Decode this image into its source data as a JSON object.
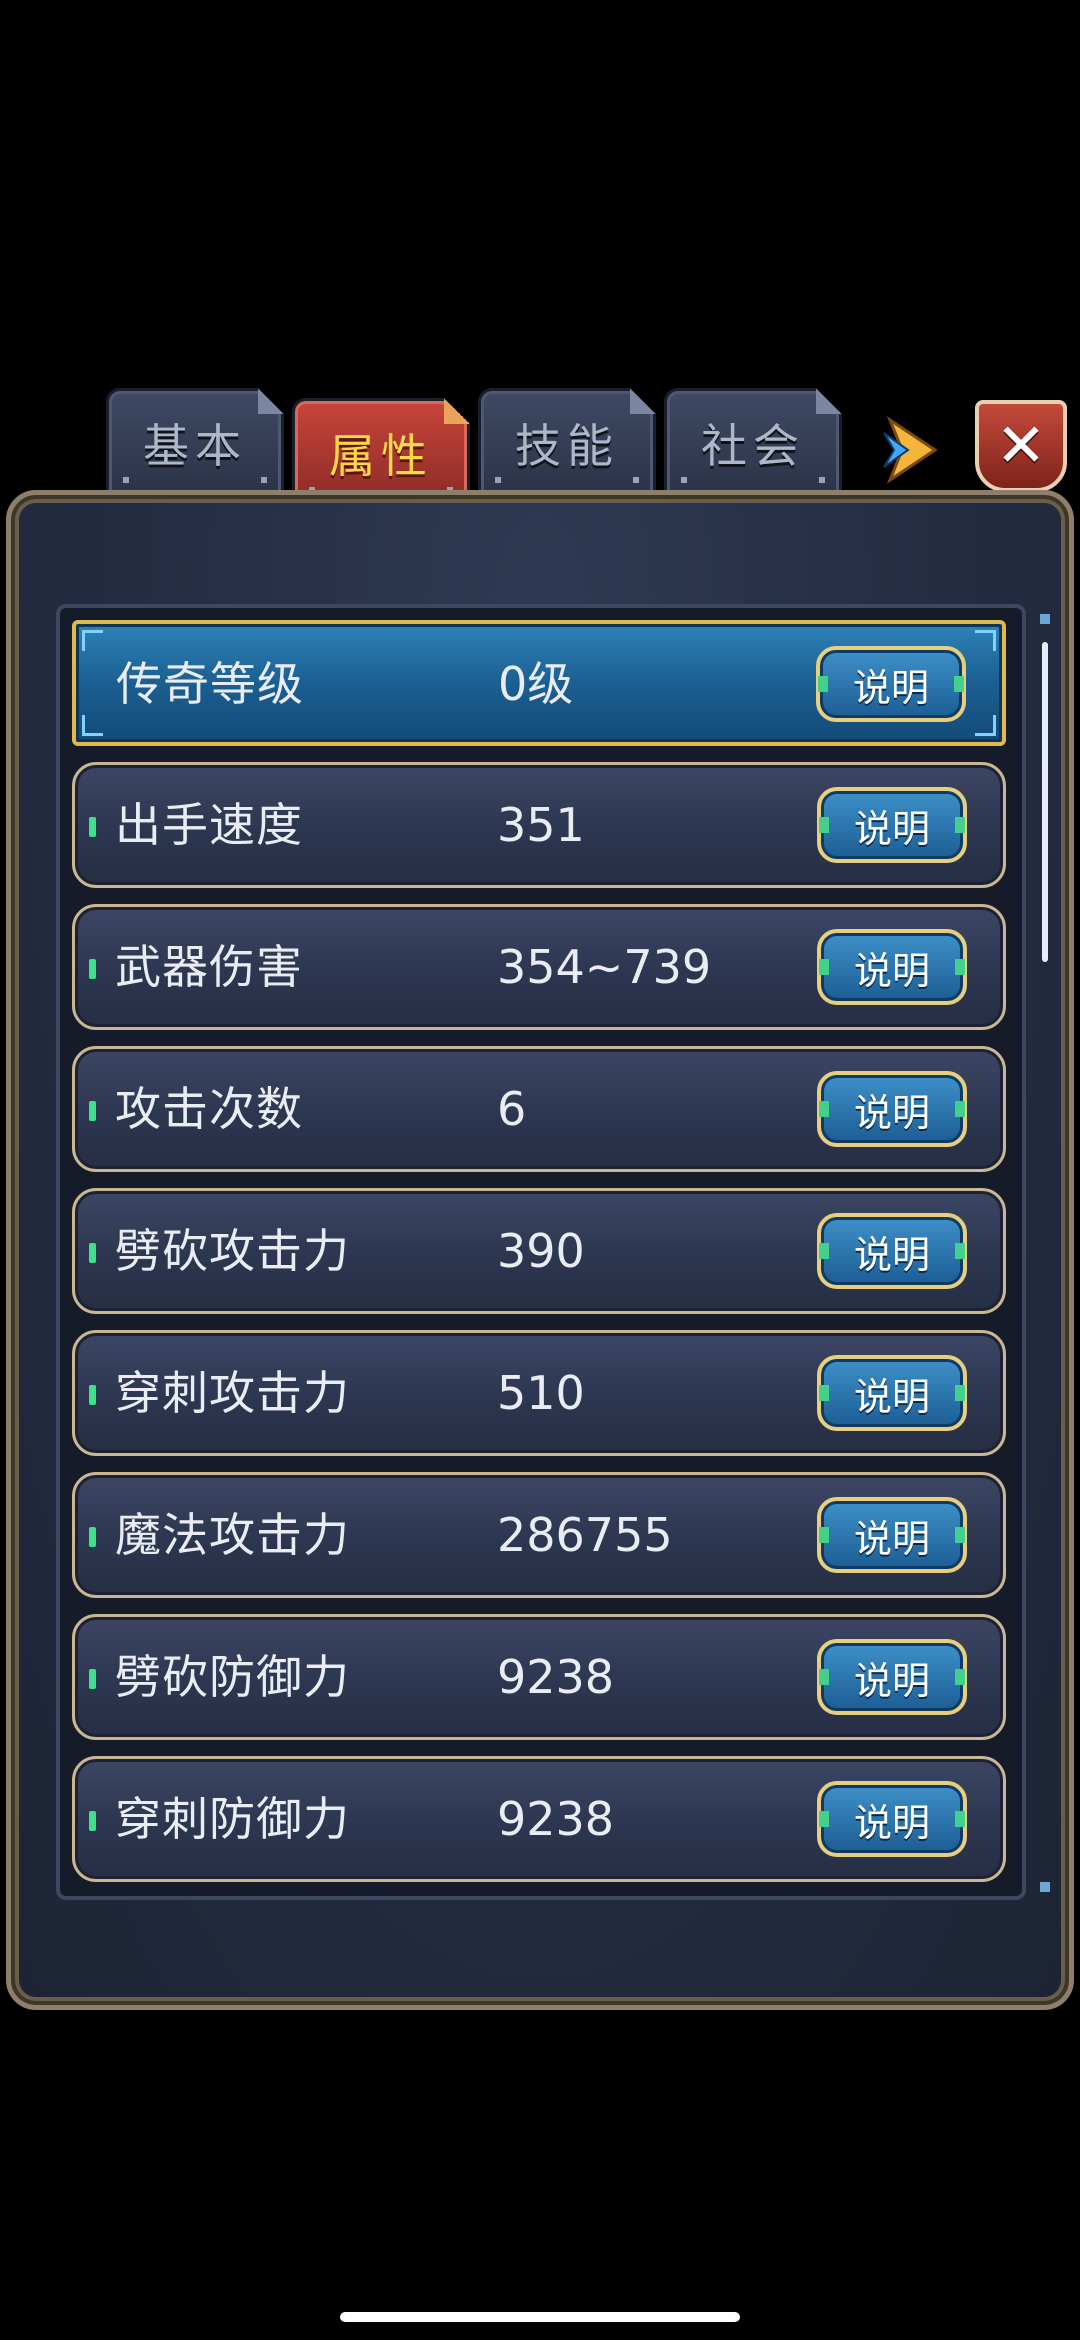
{
  "tabs": [
    {
      "label": "基本",
      "active": false
    },
    {
      "label": "属性",
      "active": true
    },
    {
      "label": "技能",
      "active": false
    },
    {
      "label": "社会",
      "active": false
    }
  ],
  "close_label": "✕",
  "rows": [
    {
      "name": "传奇等级",
      "value": "0级",
      "button": "说明",
      "selected": true
    },
    {
      "name": "出手速度",
      "value": "351",
      "button": "说明"
    },
    {
      "name": "武器伤害",
      "value": "354~739",
      "button": "说明"
    },
    {
      "name": "攻击次数",
      "value": "6",
      "button": "说明"
    },
    {
      "name": "劈砍攻击力",
      "value": "390",
      "button": "说明"
    },
    {
      "name": "穿刺攻击力",
      "value": "510",
      "button": "说明"
    },
    {
      "name": "魔法攻击力",
      "value": "286755",
      "button": "说明"
    },
    {
      "name": "劈砍防御力",
      "value": "9238",
      "button": "说明"
    },
    {
      "name": "穿刺防御力",
      "value": "9238",
      "button": "说明"
    }
  ],
  "colors": {
    "accent": "#ffd84a",
    "selected_row": "#1b5f92",
    "button": "#2a75ad"
  }
}
